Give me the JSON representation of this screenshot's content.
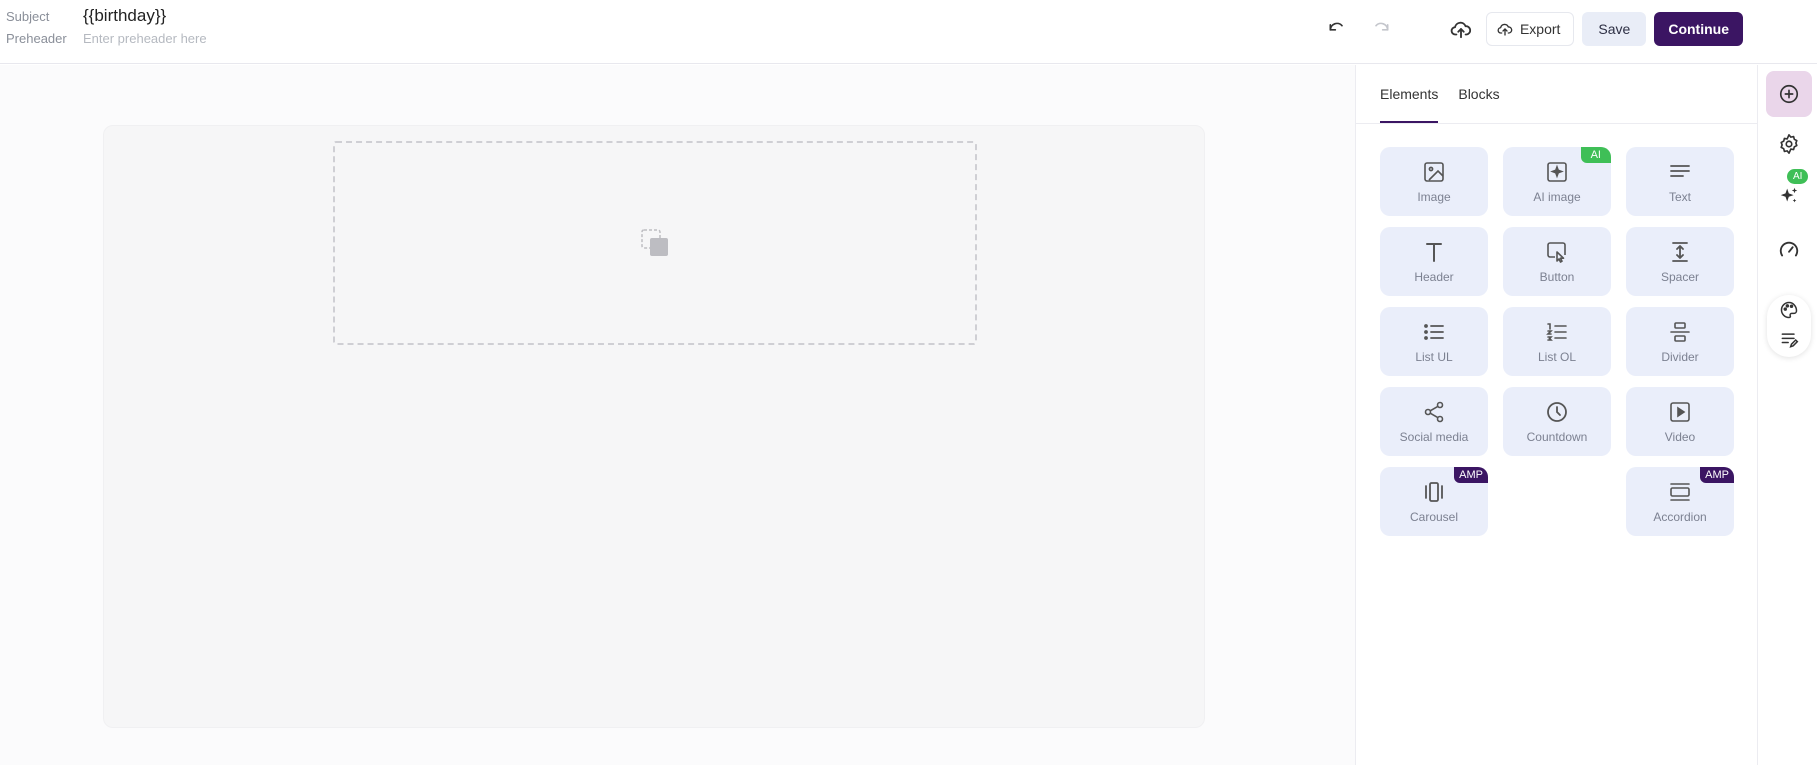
{
  "header": {
    "subject_label": "Subject",
    "subject_value": "{{birthday}}",
    "preheader_label": "Preheader",
    "preheader_placeholder": "Enter preheader here"
  },
  "toolbar": {
    "undo_icon": "undo-icon",
    "redo_icon": "redo-icon",
    "upload_icon": "cloud-upload-icon",
    "export_label": "Export",
    "save_label": "Save",
    "continue_label": "Continue"
  },
  "panel": {
    "tabs": [
      {
        "label": "Elements",
        "active": true
      },
      {
        "label": "Blocks",
        "active": false
      }
    ],
    "elements": [
      {
        "label": "Image",
        "icon": "image-icon"
      },
      {
        "label": "AI image",
        "icon": "ai-image-icon",
        "badge": "AI"
      },
      {
        "label": "Text",
        "icon": "text-icon"
      },
      {
        "label": "Header",
        "icon": "header-icon"
      },
      {
        "label": "Button",
        "icon": "button-icon"
      },
      {
        "label": "Spacer",
        "icon": "spacer-icon"
      },
      {
        "label": "List UL",
        "icon": "list-ul-icon"
      },
      {
        "label": "List OL",
        "icon": "list-ol-icon"
      },
      {
        "label": "Divider",
        "icon": "divider-icon"
      },
      {
        "label": "Social media",
        "icon": "share-icon"
      },
      {
        "label": "Countdown",
        "icon": "clock-icon"
      },
      {
        "label": "Video",
        "icon": "video-icon"
      },
      {
        "label": "Carousel",
        "icon": "carousel-icon",
        "badge": "AMP"
      },
      {
        "label": "Accordion",
        "icon": "accordion-icon",
        "badge": "AMP"
      }
    ]
  },
  "rail": {
    "items": [
      "add-icon",
      "settings-icon",
      "ai-sparkle-icon",
      "speedometer-icon",
      "palette-icon",
      "edit-lines-icon"
    ],
    "ai_badge": "AI"
  },
  "colors": {
    "brand": "#3b1563",
    "ai_green": "#3fbf57",
    "tile_bg": "#eaeefa",
    "rail_active": "#ead6ea"
  }
}
